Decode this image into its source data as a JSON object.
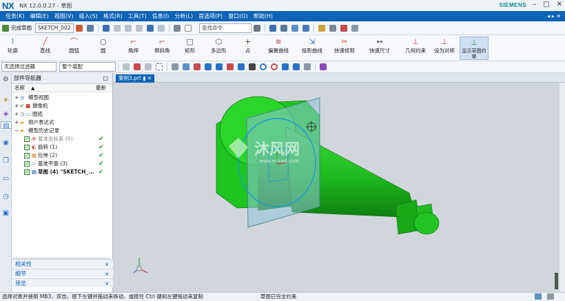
{
  "app": {
    "logo": "NX",
    "title": "NX 12.0.0.27 - 草图",
    "brand": "SIEMENS",
    "win_min": "–",
    "win_max": "□",
    "win_close": "✕",
    "menus": [
      "任务(K)",
      "编辑(E)",
      "视图(V)",
      "插入(S)",
      "格式(R)",
      "工具(T)",
      "信息(I)",
      "分析(L)",
      "首选项(P)",
      "窗口(O)",
      "帮助(H)"
    ],
    "menu_right": "◂ ▸ ✕"
  },
  "toolbar": {
    "finish_sketch": "完成草图",
    "sketch_name": "SKETCH_002",
    "search_placeholder": "查找命令"
  },
  "ribbon": {
    "buttons": [
      {
        "label": "轮廓",
        "glyph": "⌇"
      },
      {
        "label": "直线",
        "glyph": "╱"
      },
      {
        "label": "圆弧",
        "glyph": "⌒"
      },
      {
        "label": "圆",
        "glyph": "○"
      },
      {
        "label": "角焊",
        "glyph": "⌐"
      },
      {
        "label": "倒斜角",
        "glyph": "⌐"
      },
      {
        "label": "矩形",
        "glyph": "□"
      },
      {
        "label": "多边形",
        "glyph": "⬡"
      },
      {
        "label": "点",
        "glyph": "+"
      },
      {
        "label": "偏置曲线",
        "glyph": "≋"
      },
      {
        "label": "投影曲线",
        "glyph": "⇲"
      },
      {
        "label": "快速修剪",
        "glyph": "✂"
      },
      {
        "label": "快速尺寸",
        "glyph": "↔"
      },
      {
        "label": "几何约束",
        "glyph": "⊥"
      },
      {
        "label": "设为对称",
        "glyph": "⊥"
      },
      {
        "label": "显示草图约束",
        "glyph": "⊥"
      }
    ]
  },
  "filter": {
    "selection_filter": "无选择过滤器",
    "assembly_scope": "整个装配"
  },
  "navigator": {
    "title": "部件导航器",
    "col_name": "名称",
    "col_latest": "最新",
    "items": [
      {
        "label": "模型视图",
        "indent": 0
      },
      {
        "label": "摄像机",
        "indent": 0
      },
      {
        "label": "图纸",
        "indent": 0
      },
      {
        "label": "用户表达式",
        "indent": 0
      },
      {
        "label": "模型历史记录",
        "indent": 0
      },
      {
        "label": "基准坐标系 (0)",
        "indent": 1,
        "latest": "✔"
      },
      {
        "label": "旋转 (1)",
        "indent": 1,
        "latest": "✔"
      },
      {
        "label": "拉伸 (2)",
        "indent": 1,
        "latest": "✔"
      },
      {
        "label": "基准平面 (3)",
        "indent": 1,
        "latest": "✔"
      },
      {
        "label": "草图 (4) \"SKETCH_...",
        "indent": 1,
        "latest": "✔"
      }
    ],
    "panels": [
      "相关性",
      "细节",
      "预览"
    ]
  },
  "viewport": {
    "tab_label": "案例3.prt",
    "watermark_text": "沐风网",
    "watermark_url": "www.mfcad.com"
  },
  "status": {
    "message": "选择对象并使用 MB3，双击，按下左键并拖动来移动，或按住 Ctrl 键和左键拖动来复制",
    "sketch_status": "草图已完全约束"
  },
  "colors": {
    "menubar": "#0d63b5",
    "part_green": "#1fc51f",
    "plane": "#8fc4d8"
  }
}
